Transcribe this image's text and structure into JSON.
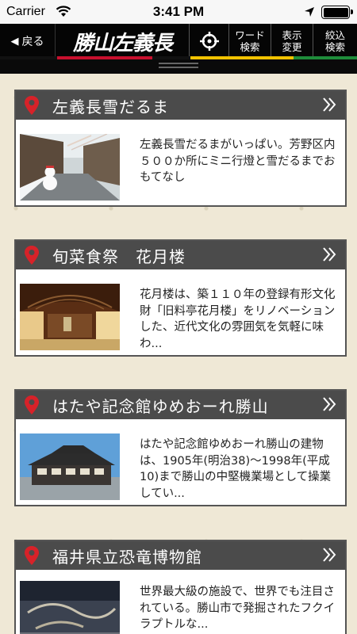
{
  "status_bar": {
    "carrier": "Carrier",
    "time": "3:41 PM"
  },
  "nav": {
    "back_label": "戻る",
    "logo_text": "勝山左義長",
    "word_search": [
      "ワード",
      "検索"
    ],
    "display_change": [
      "表示",
      "変更"
    ],
    "filter_search": [
      "絞込",
      "検索"
    ],
    "stripe_colors": [
      "#111111",
      "#c8102e",
      "#111111",
      "#f2c200",
      "#1e8c3a"
    ]
  },
  "cards": [
    {
      "title": "左義長雪だるま",
      "description": "左義長雪だるまがいっぱい。芳野区内５００か所にミニ行燈と雪だるまでおもてなし",
      "image": "snowman-street-photo"
    },
    {
      "title": "旬菜食祭　花月楼",
      "description": "花月楼は、築１１０年の登録有形文化財「旧料亭花月楼」をリノベーションした、近代文化の雰囲気を気軽に味わ...",
      "image": "tatami-hall-photo"
    },
    {
      "title": "はたや記念館ゆめおーれ勝山",
      "description": "はたや記念館ゆめおーれ勝山の建物は、1905年(明治38)～1998年(平成10)まで勝山の中堅機業場として操業してい...",
      "image": "museum-building-photo"
    },
    {
      "title": "福井県立恐竜博物館",
      "description": "世界最大級の施設で、世界でも注目されている。勝山市で発掘されたフクイラプトルな...",
      "image": "dinosaur-museum-photo"
    }
  ]
}
